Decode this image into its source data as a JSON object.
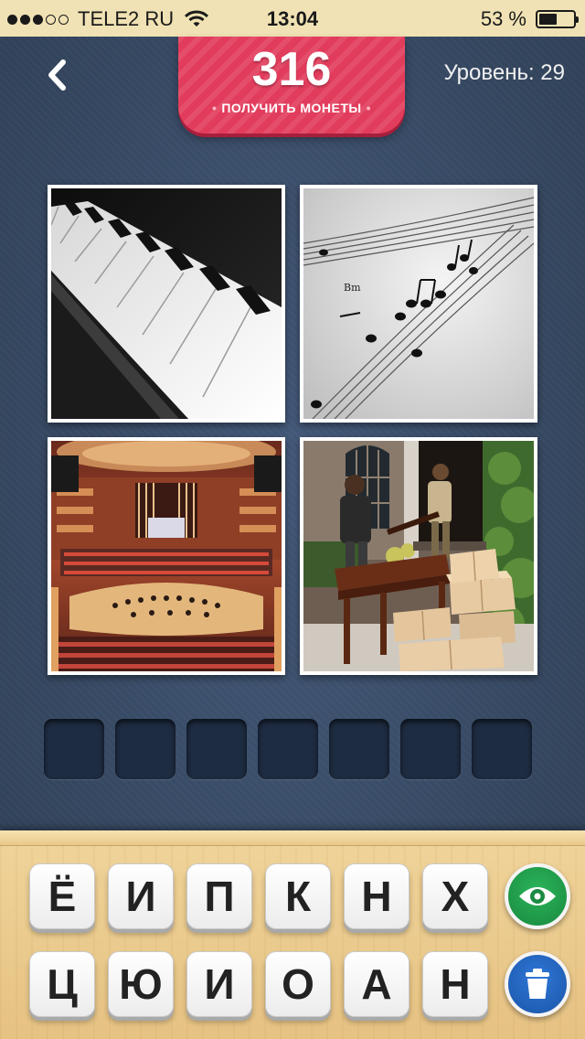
{
  "status_bar": {
    "carrier": "TELE2 RU",
    "time": "13:04",
    "battery_percent_label": "53 %",
    "battery_level": 0.53,
    "signal_dots_filled": 3,
    "signal_dots_total": 5
  },
  "header": {
    "coins": "316",
    "get_coins_label": "ПОЛУЧИТЬ МОНЕТЫ",
    "level_label": "Уровень: 29"
  },
  "photos": [
    {
      "subject": "piano-keys"
    },
    {
      "subject": "sheet-music"
    },
    {
      "subject": "concert-hall"
    },
    {
      "subject": "movers-carrying-piano"
    }
  ],
  "answer": {
    "slot_count": 7,
    "letters": [
      "",
      "",
      "",
      "",
      "",
      "",
      ""
    ]
  },
  "keyboard": {
    "row1": [
      "Ё",
      "И",
      "П",
      "К",
      "Н",
      "Х"
    ],
    "row2": [
      "Ц",
      "Ю",
      "И",
      "О",
      "А",
      "Н"
    ]
  },
  "hints": {
    "reveal_icon": "eye-icon",
    "remove_icon": "trash-icon"
  },
  "colors": {
    "banner": "#e23c5c",
    "background": "#3a4d67",
    "tray": "#eacb8c",
    "reveal": "#1f9a48",
    "remove": "#2366c2"
  }
}
